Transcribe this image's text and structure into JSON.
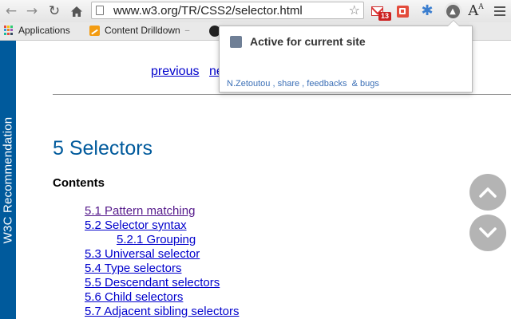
{
  "browser": {
    "url": "www.w3.org/TR/CSS2/selector.html",
    "extensions": {
      "gmail_badge": "13",
      "font_ext_label": "A",
      "font_ext_small": "A"
    }
  },
  "bookmarks": [
    {
      "label": "Applications",
      "icon": "apps-grid-icon"
    },
    {
      "label": "Content Drilldown",
      "icon": "drilldown-icon",
      "has_menu": true
    }
  ],
  "page": {
    "sidebar_label": "W3C Recommendation",
    "nav": {
      "previous": "previous",
      "next_partial": "ne"
    },
    "title": "5 Selectors",
    "contents_heading": "Contents",
    "toc": [
      {
        "label": "5.1 Pattern matching",
        "visited": true
      },
      {
        "label": "5.2 Selector syntax",
        "visited": false
      },
      {
        "label": "5.2.1 Grouping",
        "visited": false,
        "nested": true
      },
      {
        "label": "5.3 Universal selector",
        "visited": false
      },
      {
        "label": "5.4 Type selectors",
        "visited": false
      },
      {
        "label": "5.5 Descendant selectors",
        "visited": false
      },
      {
        "label": "5.6 Child selectors",
        "visited": false
      },
      {
        "label": "5.7 Adjacent sibling selectors",
        "visited": false
      }
    ]
  },
  "popup": {
    "checkbox_label": "Active for current site",
    "footer": {
      "author": "N.Zetoutou",
      "sep1": " , ",
      "share": "share",
      "sep2": " , ",
      "feedbacks": "feedbacks",
      "sep3": "  & ",
      "bugs": "bugs"
    }
  },
  "colors": {
    "sidebar": "#005a9c",
    "title": "#005a9c",
    "link": "#0000cc",
    "visited_link": "#551a8b",
    "popup_link": "#3b6fb6"
  }
}
